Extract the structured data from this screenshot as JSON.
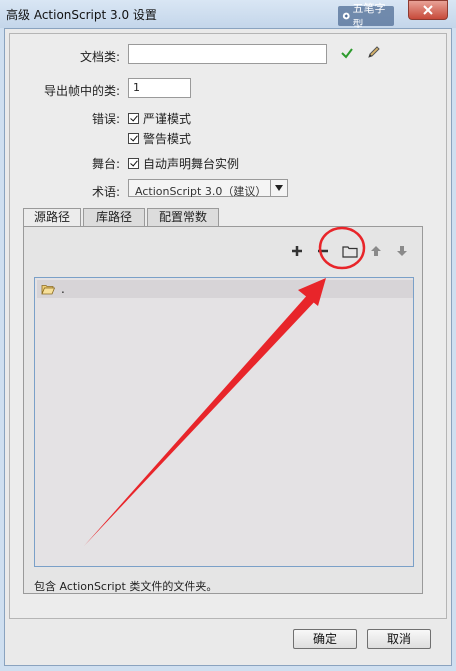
{
  "window": {
    "title": "高级 ActionScript 3.0 设置"
  },
  "watermark": {
    "text": "五笔字型"
  },
  "form": {
    "doc_class_label": "文档类:",
    "doc_class_value": "",
    "export_frame_label": "导出帧中的类:",
    "export_frame_value": "1",
    "errors_label": "错误:",
    "strict_mode": "严谨模式",
    "warnings_mode": "警告模式",
    "stage_label": "舞台:",
    "auto_declare": "自动声明舞台实例",
    "dialect_label": "术语:",
    "dialect_value": "ActionScript 3.0（建议）"
  },
  "tabs": [
    {
      "label": "源路径"
    },
    {
      "label": "库路径"
    },
    {
      "label": "配置常数"
    }
  ],
  "source_path": {
    "items": [
      {
        "label": "."
      }
    ],
    "hint": "包含 ActionScript 类文件的文件夹。"
  },
  "buttons": {
    "ok": "确定",
    "cancel": "取消"
  },
  "colors": {
    "annotation": "#e8252a",
    "validate": "#2d9b2d"
  }
}
